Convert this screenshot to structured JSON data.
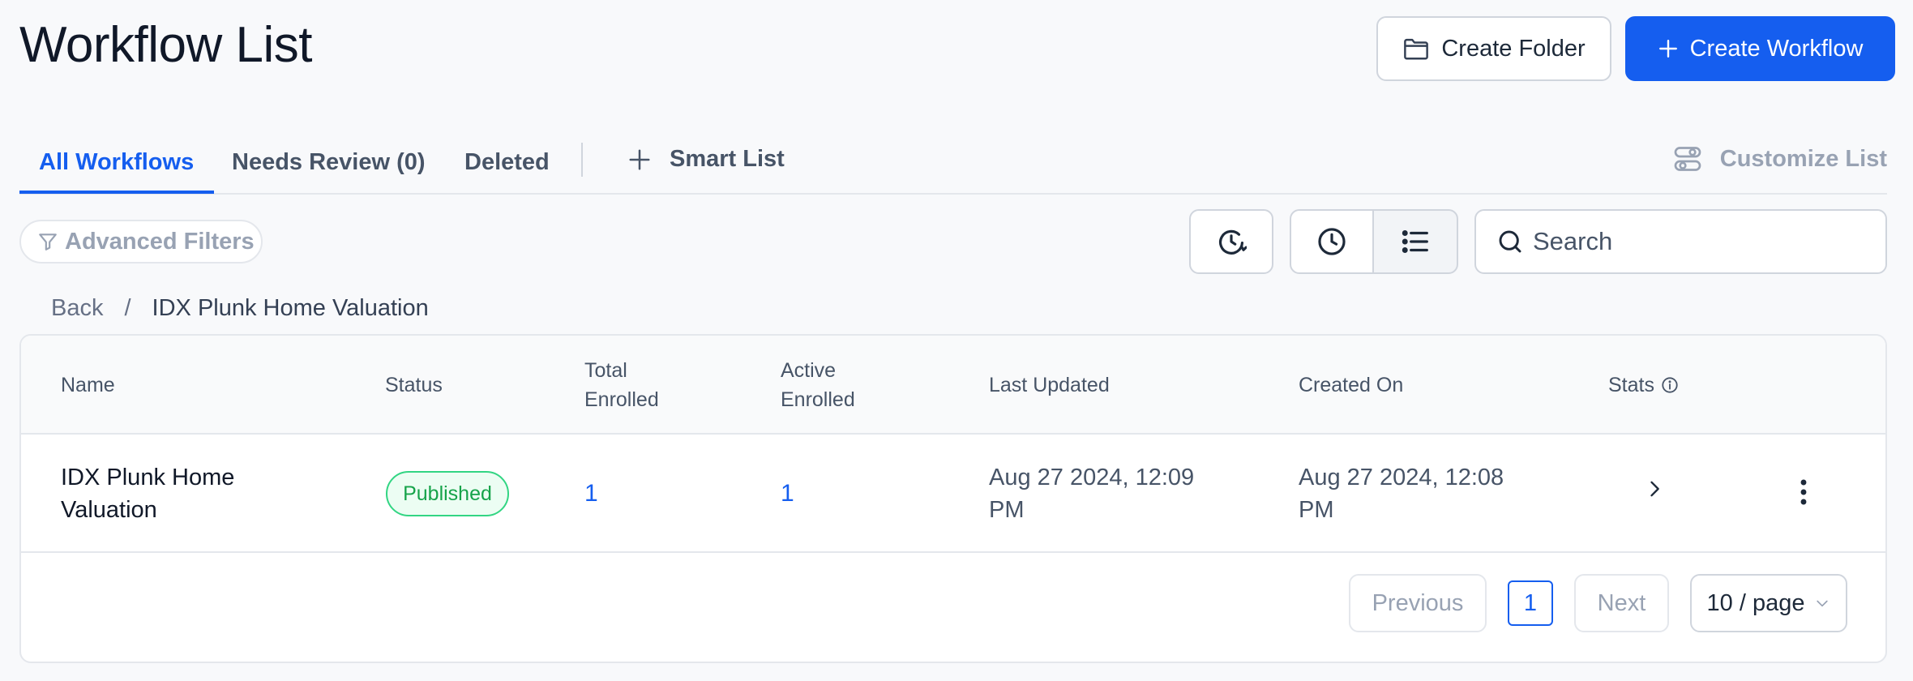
{
  "page": {
    "title": "Workflow List"
  },
  "actions": {
    "create_folder": "Create Folder",
    "create_workflow": "Create Workflow"
  },
  "tabs": [
    {
      "label": "All Workflows",
      "active": true
    },
    {
      "label": "Needs Review (0)",
      "active": false
    },
    {
      "label": "Deleted",
      "active": false
    }
  ],
  "smart_list": {
    "label": "Smart List"
  },
  "customize_list": {
    "label": "Customize List"
  },
  "filters": {
    "advanced_label": "Advanced Filters"
  },
  "search": {
    "placeholder": "Search",
    "value": ""
  },
  "breadcrumb": {
    "back": "Back",
    "separator": "/",
    "current": "IDX Plunk Home Valuation"
  },
  "table": {
    "columns": {
      "name": "Name",
      "status": "Status",
      "total_enrolled_1": "Total",
      "total_enrolled_2": "Enrolled",
      "active_enrolled_1": "Active",
      "active_enrolled_2": "Enrolled",
      "last_updated": "Last Updated",
      "created_on": "Created On",
      "stats": "Stats"
    },
    "rows": [
      {
        "name": "IDX Plunk Home Valuation",
        "status": "Published",
        "total_enrolled": "1",
        "active_enrolled": "1",
        "last_updated": "Aug 27 2024, 12:09 PM",
        "created_on": "Aug 27 2024, 12:08 PM"
      }
    ]
  },
  "pagination": {
    "previous": "Previous",
    "current_page": "1",
    "next": "Next",
    "page_size": "10 / page"
  },
  "colors": {
    "accent": "#155eef",
    "published_green": "#16a34a"
  }
}
